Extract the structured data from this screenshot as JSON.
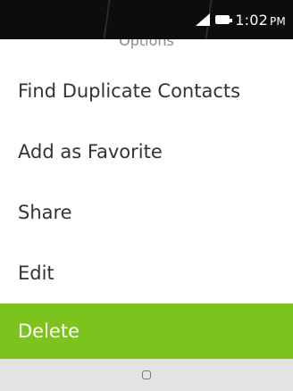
{
  "status_bar": {
    "time": "1:02",
    "ampm": "PM",
    "signal_icon": "signal-icon",
    "battery_icon": "battery-icon"
  },
  "header": {
    "title": "Options"
  },
  "menu": {
    "items": [
      {
        "label": "Find Duplicate Contacts",
        "selected": false
      },
      {
        "label": "Add as Favorite",
        "selected": false
      },
      {
        "label": "Share",
        "selected": false
      },
      {
        "label": "Edit",
        "selected": false
      },
      {
        "label": "Delete",
        "selected": true
      }
    ]
  },
  "softkeys": {
    "center_icon": "center-softkey-icon"
  },
  "colors": {
    "accent": "#7dc31e",
    "status_bar_bg": "#0d0d0d",
    "softkey_bg": "#e3e3e3"
  }
}
